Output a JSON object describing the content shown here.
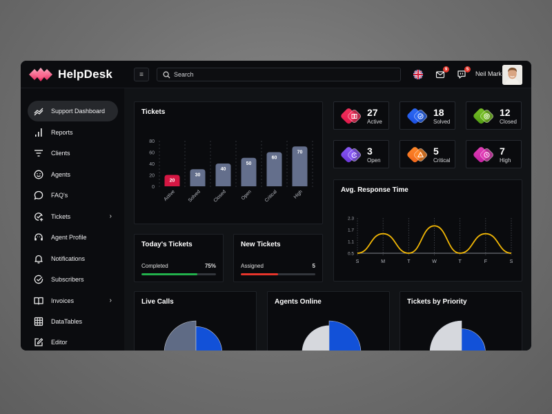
{
  "app": {
    "name": "HelpDesk"
  },
  "topbar": {
    "menu_icon": "hamburger-icon",
    "search_placeholder": "Search",
    "language_icon": "uk-flag-icon",
    "mail_badge": "9",
    "chat_badge": "5",
    "user_name": "Neil Mark"
  },
  "sidebar": {
    "items": [
      {
        "label": "Support Dashboard",
        "icon": "trend-chart-icon",
        "active": true
      },
      {
        "label": "Reports",
        "icon": "bar-chart-icon"
      },
      {
        "label": "Clients",
        "icon": "filter-icon"
      },
      {
        "label": "Agents",
        "icon": "smiley-icon"
      },
      {
        "label": "FAQ's",
        "icon": "chat-bubble-icon"
      },
      {
        "label": "Tickets",
        "icon": "check-plus-icon",
        "has_submenu": true
      },
      {
        "label": "Agent Profile",
        "icon": "headset-icon"
      },
      {
        "label": "Notifications",
        "icon": "bell-icon"
      },
      {
        "label": "Subscribers",
        "icon": "check-circle-icon"
      },
      {
        "label": "Invoices",
        "icon": "book-icon",
        "has_submenu": true
      },
      {
        "label": "DataTables",
        "icon": "grid-icon"
      },
      {
        "label": "Editor",
        "icon": "edit-icon"
      }
    ],
    "chevron": "›"
  },
  "tickets_chart": {
    "title": "Tickets"
  },
  "stats": [
    {
      "value": "27",
      "label": "Active",
      "color1": "#f0345e",
      "color2": "#e0174a",
      "icon": "book-icon"
    },
    {
      "value": "18",
      "label": "Solved",
      "color1": "#2f6cf6",
      "color2": "#1b4fe0",
      "icon": "check-icon"
    },
    {
      "value": "12",
      "label": "Closed",
      "color1": "#7cc22a",
      "color2": "#4e9a12",
      "icon": "target-icon"
    },
    {
      "value": "3",
      "label": "Open",
      "color1": "#8b5cf6",
      "color2": "#6a35d8",
      "icon": "refresh-icon"
    },
    {
      "value": "5",
      "label": "Critical",
      "color1": "#ff8a2a",
      "color2": "#f0641a",
      "icon": "warning-icon"
    },
    {
      "value": "7",
      "label": "High",
      "color1": "#e441b8",
      "color2": "#c21fa0",
      "icon": "clock-icon"
    }
  ],
  "response_chart": {
    "title": "Avg. Response Time"
  },
  "todays_tickets": {
    "title": "Today's Tickets",
    "label": "Completed",
    "value": "75%",
    "progress": 0.75,
    "color": "#22b24c"
  },
  "new_tickets": {
    "title": "New Tickets",
    "label": "Assigned",
    "value": "5",
    "progress": 0.5,
    "color": "#e8352b"
  },
  "live_calls": {
    "title": "Live Calls"
  },
  "agents_online": {
    "title": "Agents Online"
  },
  "tickets_priority": {
    "title": "Tickets by Priority"
  },
  "chart_data": [
    {
      "type": "bar",
      "title": "Tickets",
      "categories": [
        "Active",
        "Solved",
        "Closed",
        "Open",
        "Critical",
        "High"
      ],
      "values": [
        20,
        30,
        40,
        50,
        60,
        70
      ],
      "highlight_index": 0,
      "colors": {
        "highlight": "#d51743",
        "default": "#646f8c"
      },
      "yticks": [
        0,
        20,
        40,
        60,
        80
      ],
      "ylim": [
        0,
        80
      ],
      "xlabel": "",
      "ylabel": "",
      "grid": "vertical-dashed"
    },
    {
      "type": "line",
      "title": "Avg. Response Time",
      "categories": [
        "S",
        "M",
        "T",
        "W",
        "T",
        "F",
        "S"
      ],
      "values": [
        0.5,
        1.5,
        0.5,
        1.9,
        0.5,
        1.5,
        0.5
      ],
      "yticks": [
        0.5,
        1.1,
        1.7,
        2.3
      ],
      "ylim": [
        0.5,
        2.3
      ],
      "color": "#f2b705",
      "xlabel": "",
      "ylabel": "",
      "grid": "vertical-dotted"
    },
    {
      "type": "pie",
      "title": "Live Calls",
      "slices": [
        {
          "value": 50,
          "color": "#5f6b85"
        },
        {
          "value": 50,
          "color": "#1251d8"
        }
      ],
      "radius_scale": [
        1.0,
        0.82
      ]
    },
    {
      "type": "pie",
      "title": "Agents Online",
      "slices": [
        {
          "value": 50,
          "color": "#d6d8dd"
        },
        {
          "value": 50,
          "color": "#1251d8"
        }
      ],
      "radius_scale": [
        0.85,
        1.0
      ]
    },
    {
      "type": "pie",
      "title": "Tickets by Priority",
      "slices": [
        {
          "value": 50,
          "color": "#d6d8dd"
        },
        {
          "value": 50,
          "color": "#1251d8"
        }
      ],
      "radius_scale": [
        1.0,
        0.75
      ]
    }
  ]
}
